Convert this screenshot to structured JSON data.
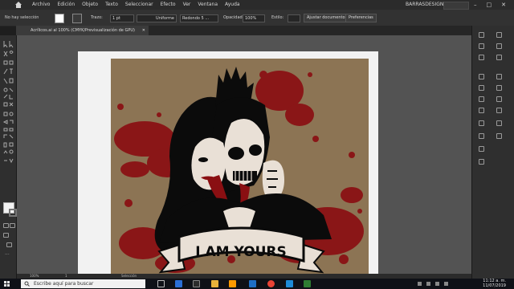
{
  "menubar": {
    "items": [
      "Archivo",
      "Edición",
      "Objeto",
      "Texto",
      "Seleccionar",
      "Efecto",
      "Ver",
      "Ventana",
      "Ayuda"
    ],
    "brand": "BARRASDESIGNS",
    "window_controls": [
      "–",
      "□",
      "✕"
    ]
  },
  "control_bar": {
    "selection_status": "No hay selección",
    "stroke_label": "Trazo:",
    "stroke_value": "1 pt",
    "stroke_profile": "Uniforme",
    "brush": "Redondo 5 ...",
    "opacity_label": "Opacidad:",
    "opacity_value": "100%",
    "style_label": "Estilo:",
    "adjust_button": "Ajustar documento",
    "prefs_button": "Preferencias"
  },
  "document": {
    "tab_title": "Acrílicos.ai al 100% (CMYK/Previsualización de GPU)",
    "close": "✕",
    "art_caption": "I AM YOURS"
  },
  "status_bar": {
    "zoom": "100%",
    "page": "1",
    "tool": "Selección"
  },
  "taskbar": {
    "search_placeholder": "Escribe aquí para buscar",
    "time": "11:12 a. m.",
    "date": "11/07/2019"
  },
  "colors": {
    "art_background": "#8c7454",
    "blood": "#8a0f12",
    "ink": "#0b0b0b"
  }
}
